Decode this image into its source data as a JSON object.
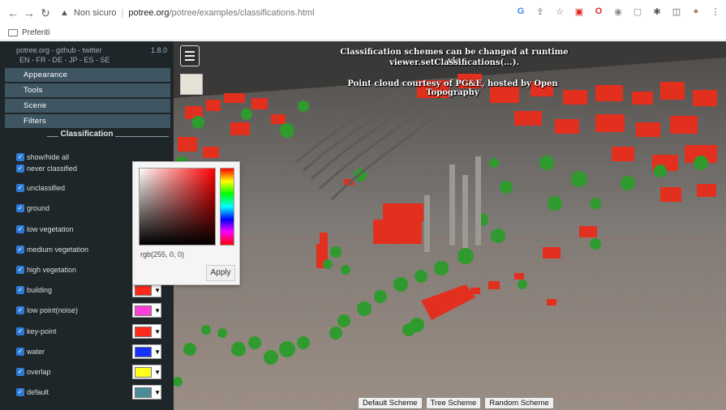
{
  "browser": {
    "not_secure": "Non sicuro",
    "url_host": "potree.org",
    "url_path": "/potree/examples/classifications.html",
    "bookmarks_folder": "Preferiti"
  },
  "sidebar": {
    "header_links": "potree.org - github - twitter",
    "version": "1.8.0",
    "languages": "EN - FR - DE - JP - ES - SE",
    "accordion": [
      "Appearance",
      "Tools",
      "Scene",
      "Filters"
    ],
    "section_title": "Classification",
    "classes": [
      {
        "label": "show/hide all",
        "color": null
      },
      {
        "label": "never classified",
        "color": null
      },
      {
        "label": "unclassified",
        "color": null
      },
      {
        "label": "ground",
        "color": null
      },
      {
        "label": "low vegetation",
        "color": null
      },
      {
        "label": "medium vegetation",
        "color": null
      },
      {
        "label": "high vegetation",
        "color": null
      },
      {
        "label": "building",
        "color": "#ff2a1a"
      },
      {
        "label": "low point(noise)",
        "color": "#ff3fd8"
      },
      {
        "label": "key-point",
        "color": "#ff2a1a"
      },
      {
        "label": "water",
        "color": "#1433ff"
      },
      {
        "label": "overlap",
        "color": "#ffff1a"
      },
      {
        "label": "default",
        "color": "#4a8c98"
      }
    ]
  },
  "viewport": {
    "caption_line1": "Classification schemes can be changed at runtime via",
    "caption_line2": "viewer.setClassifications(...).",
    "credit": "Point cloud courtesy of PG&E, hosted by Open Topography",
    "scheme_buttons": [
      "Default Scheme",
      "Tree Scheme",
      "Random Scheme"
    ]
  },
  "color_picker": {
    "value": "rgb(255, 0, 0)",
    "apply_label": "Apply"
  },
  "colors": {
    "building": "#e3301e",
    "vegetation": "#2f9a2e",
    "ground": "#86817c"
  }
}
